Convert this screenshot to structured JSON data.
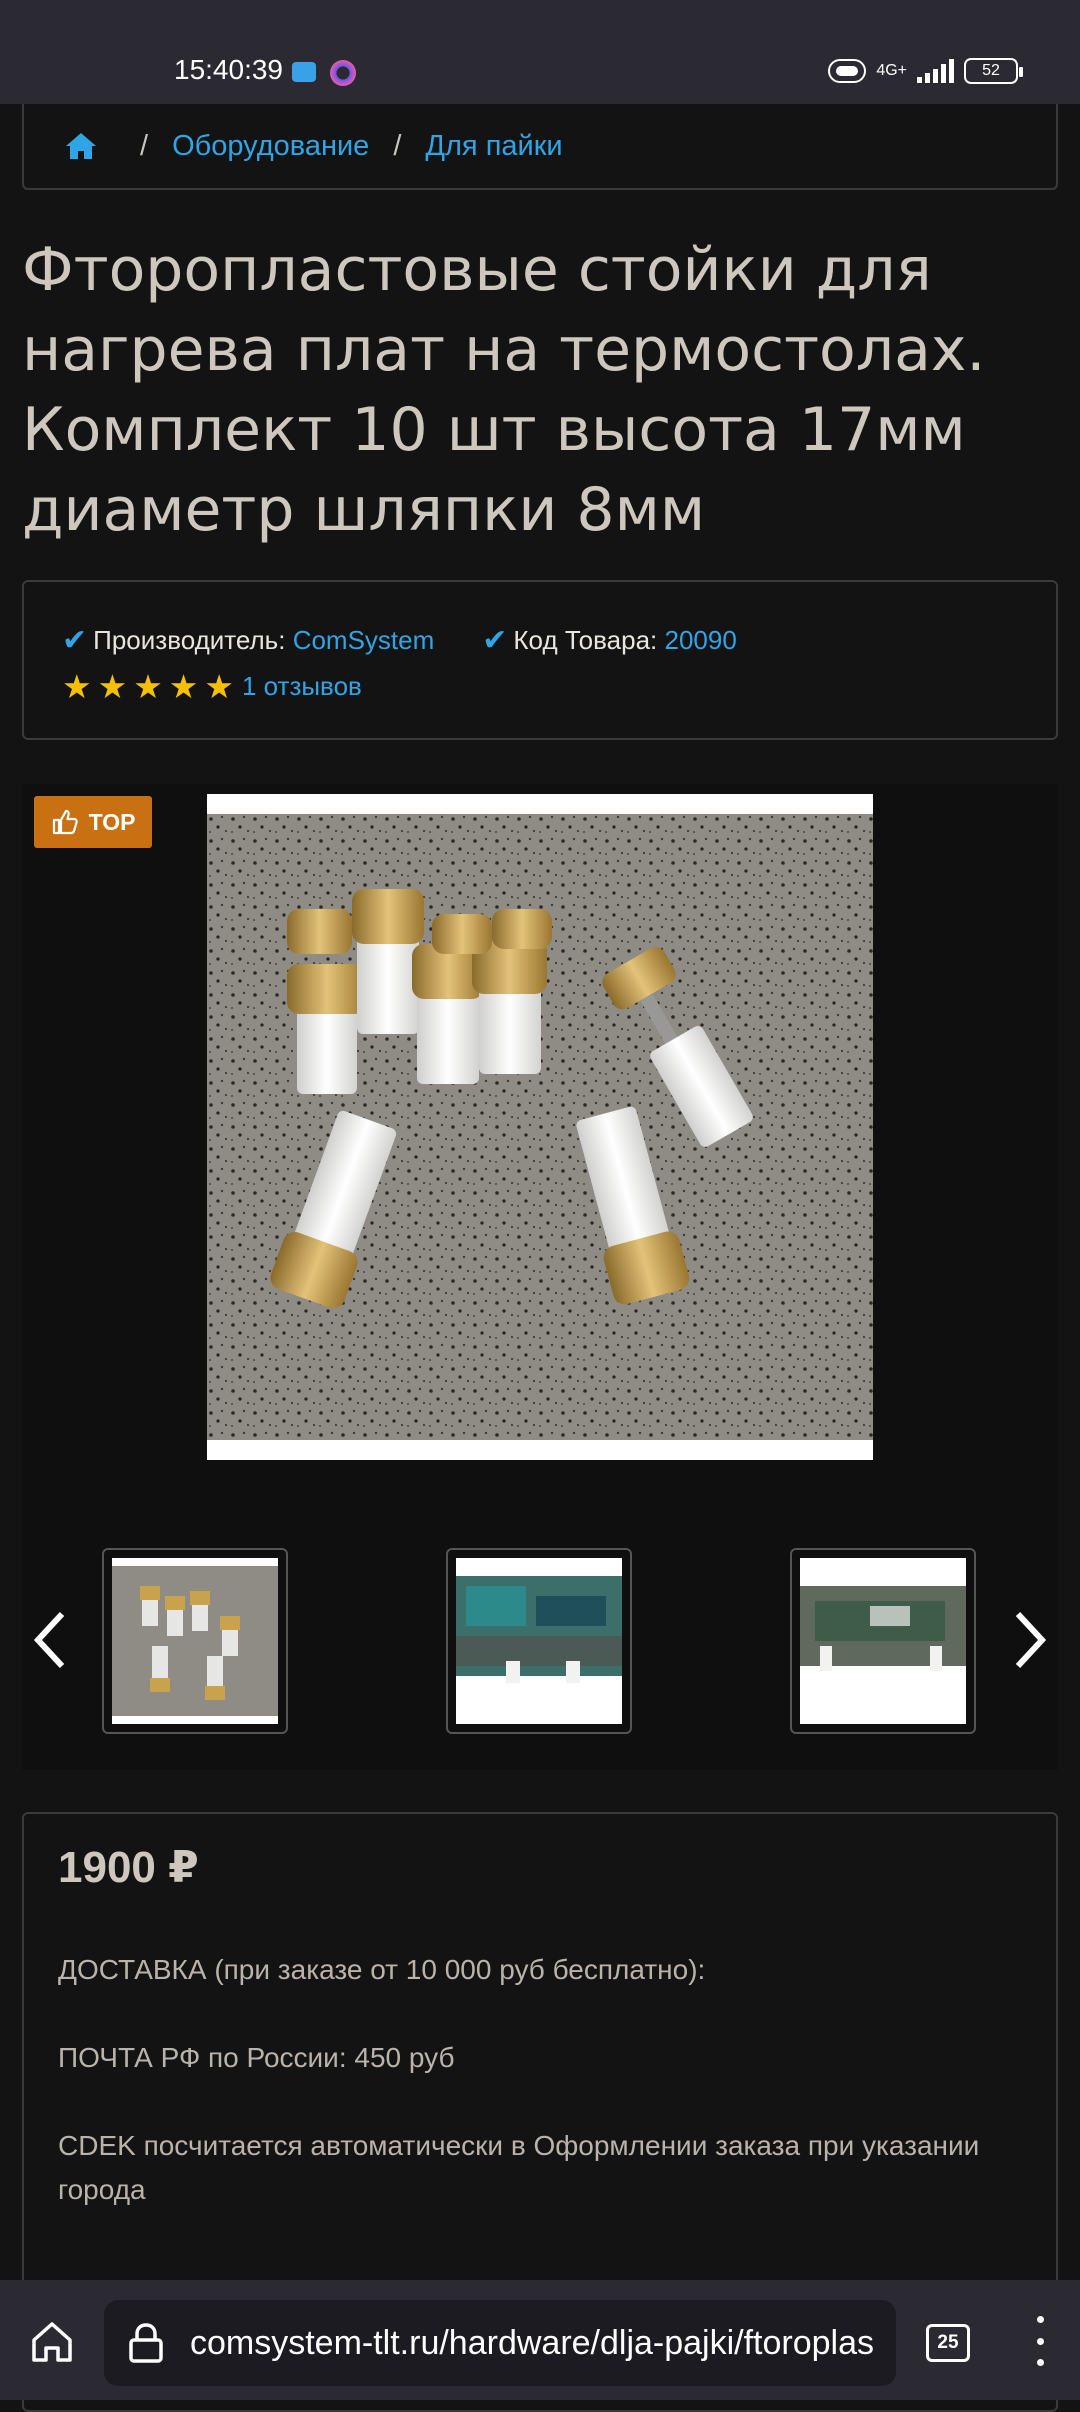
{
  "status_bar": {
    "time": "15:40:39",
    "network": "4G+",
    "battery": "52"
  },
  "breadcrumb": {
    "items": [
      "Оборудование",
      "Для пайки"
    ],
    "separator": "/"
  },
  "product": {
    "title": "Фторопластовые стойки для нагрева плат на термостолах. Комплект 10 шт высота 17мм диаметр шляпки 8мм",
    "manufacturer_label": "Производитель:",
    "manufacturer": "ComSystem",
    "code_label": "Код Товара:",
    "code": "20090",
    "rating": 5,
    "reviews": "1 отзывов",
    "badge": "TOP",
    "price": "1900 ₽",
    "delivery_lines": [
      "ДОСТАВКА (при заказе от 10 000 руб бесплатно):",
      "ПОЧТА РФ по России: 450 руб",
      "CDEK посчитается автоматически в Оформлении заказа при указании города"
    ]
  },
  "browser": {
    "url": "comsystem-tlt.ru/hardware/dlja-pajki/ftoroplas",
    "tab_count": "25"
  },
  "colors": {
    "accent": "#2fa4e7",
    "badge": "#c97012",
    "star": "#f5c000",
    "background": "#131313"
  }
}
